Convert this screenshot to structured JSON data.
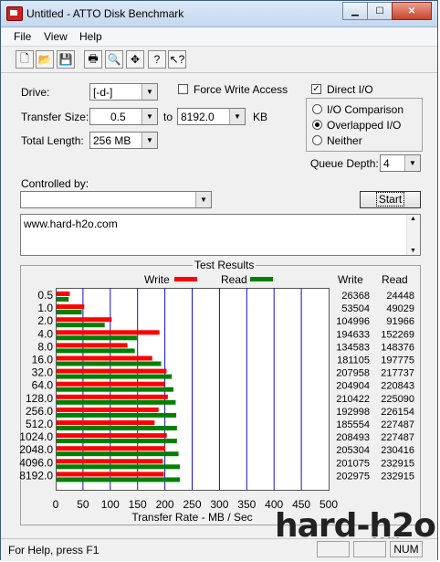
{
  "window": {
    "title": "Untitled - ATTO Disk Benchmark"
  },
  "menu": [
    "File",
    "View",
    "Help"
  ],
  "toolbar": [
    {
      "name": "new-icon",
      "glyph": "🗋"
    },
    {
      "name": "open-icon",
      "glyph": "📂"
    },
    {
      "name": "save-icon",
      "glyph": "💾"
    },
    {
      "name": "print-icon",
      "glyph": "🖶"
    },
    {
      "name": "print-preview-icon",
      "glyph": "🔍"
    },
    {
      "name": "move-icon",
      "glyph": "✥"
    },
    {
      "name": "help-icon",
      "glyph": "?"
    },
    {
      "name": "context-help-icon",
      "glyph": "↖?"
    }
  ],
  "settings": {
    "drive_label": "Drive:",
    "drive_value": "[-d-]",
    "force_write_label": "Force Write Access",
    "direct_io_label": "Direct I/O",
    "direct_io_checked": true,
    "transfer_size_label": "Transfer Size:",
    "transfer_from": "0.5",
    "to_label": "to",
    "transfer_to": "8192.0",
    "kb_label": "KB",
    "total_length_label": "Total Length:",
    "total_length_value": "256 MB",
    "io_comparison_label": "I/O Comparison",
    "overlapped_io_label": "Overlapped I/O",
    "neither_label": "Neither",
    "queue_depth_label": "Queue Depth:",
    "queue_depth_value": "4",
    "controlled_by_label": "Controlled by:",
    "controlled_by_value": "",
    "start_label": "Start",
    "notes": "www.hard-h2o.com"
  },
  "results": {
    "title": "Test Results",
    "write_legend": "Write",
    "read_legend": "Read",
    "write_col": "Write",
    "read_col": "Read"
  },
  "chart_data": {
    "type": "bar",
    "orientation": "horizontal",
    "categories": [
      "0.5",
      "1.0",
      "2.0",
      "4.0",
      "8.0",
      "16.0",
      "32.0",
      "64.0",
      "128.0",
      "256.0",
      "512.0",
      "1024.0",
      "2048.0",
      "4096.0",
      "8192.0"
    ],
    "series": [
      {
        "name": "Write",
        "color": "#ff0000",
        "values": [
          26368,
          53504,
          104996,
          194633,
          134583,
          181105,
          207958,
          204904,
          210422,
          192998,
          185554,
          208493,
          205304,
          201075,
          202975
        ]
      },
      {
        "name": "Read",
        "color": "#008000",
        "values": [
          24448,
          49029,
          91966,
          152269,
          148376,
          197775,
          217737,
          220843,
          225090,
          226154,
          227487,
          227487,
          230416,
          232915,
          232915
        ]
      }
    ],
    "xlabel": "Transfer Rate - MB / Sec",
    "xticks": [
      "0",
      "50",
      "100",
      "150",
      "200",
      "250",
      "300",
      "350",
      "400",
      "450",
      "500"
    ],
    "xlim": [
      0,
      500
    ],
    "grid": true,
    "legend": "top"
  },
  "status": {
    "help_text": "For Help, press F1",
    "num": "NUM"
  },
  "watermark": {
    "main": "hard-h2o",
    "sub": ".com"
  }
}
